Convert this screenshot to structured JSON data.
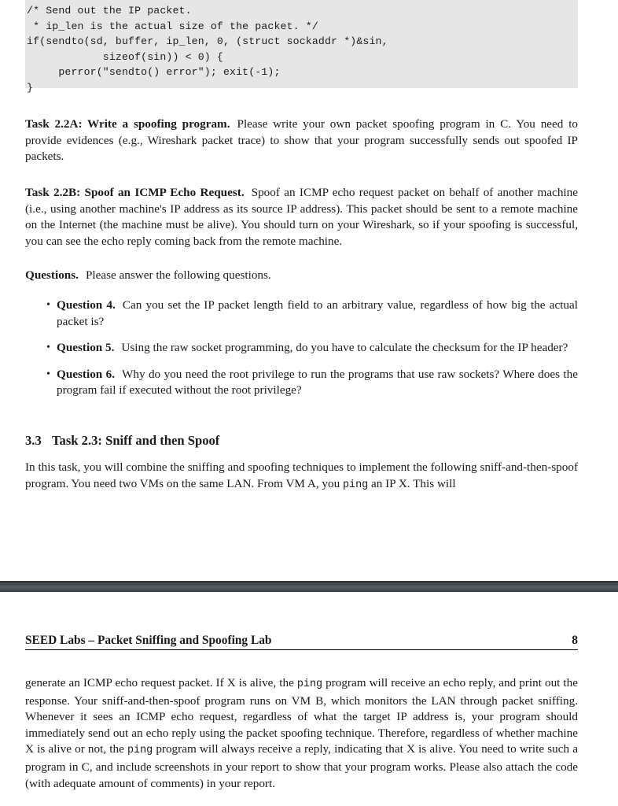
{
  "document": {
    "type": "pdf-page-view",
    "page_number_label": "8",
    "running_header": "SEED Labs – Packet Sniffing and Spoofing Lab",
    "background_color": "#ffffff",
    "text_color": "#1a1a1a",
    "divider_color": "#3c4246",
    "code_background_color": "#e6e6e6"
  },
  "code_listing": {
    "language": "c",
    "text": "/* Send out the IP packet.\n * ip_len is the actual size of the packet. */\nif(sendto(sd, buffer, ip_len, 0, (struct sockaddr *)&sin,\n            sizeof(sin)) < 0) {\n     perror(\"sendto() error\"); exit(-1);\n}"
  },
  "task_2_2a": {
    "heading": "Task 2.2A: Write a spoofing program.",
    "body": "Please write your own packet spoofing program in C. You need to provide evidences (e.g., Wireshark packet trace) to show that your program successfully sends out spoofed IP packets."
  },
  "task_2_2b": {
    "heading": "Task 2.2B: Spoof an ICMP Echo Request.",
    "body": "Spoof an ICMP echo request packet on behalf of another machine (i.e., using another machine's IP address as its source IP address). This packet should be sent to a remote machine on the Internet (the machine must be alive). You should turn on your Wireshark, so if your spoofing is successful, you can see the echo reply coming back from the remote machine."
  },
  "questions_block": {
    "heading": "Questions.",
    "intro": "Please answer the following questions.",
    "bullet_glyph": "•",
    "items": [
      {
        "label": "Question 4.",
        "text": "Can you set the IP packet length field to an arbitrary value, regardless of how big the actual packet is?"
      },
      {
        "label": "Question 5.",
        "text": "Using the raw socket programming, do you have to calculate the checksum for the IP header?"
      },
      {
        "label": "Question 6.",
        "text": "Why do you need the root privilege to run the programs that use raw sockets? Where does the program fail if executed without the root privilege?"
      }
    ]
  },
  "section_3_3": {
    "number": "3.3",
    "title": "Task 2.3: Sniff and then Spoof",
    "paragraph_part_1": "In this task, you will combine the sniffing and spoofing techniques to implement the following sniff-and-then-spoof program. You need two VMs on the same LAN. From VM A, you ",
    "paragraph_mono_1": "ping",
    "paragraph_part_2": " an IP X. This will"
  },
  "continued_paragraph": {
    "part_1": "generate an ICMP echo request packet. If X is alive, the ",
    "mono_1": "ping",
    "part_2": " program will receive an echo reply, and print out the response. Your sniff-and-then-spoof program runs on VM B, which monitors the LAN through packet sniffing. Whenever it sees an ICMP echo request, regardless of what the target IP address is, your program should immediately send out an echo reply using the packet spoofing technique. Therefore, regardless of whether machine X is alive or not, the ",
    "mono_2": "ping",
    "part_3": " program will always receive a reply, indicating that X is alive. You need to write such a program in C, and include screenshots in your report to show that your program works. Please also attach the code (with adequate amount of comments) in your report."
  }
}
